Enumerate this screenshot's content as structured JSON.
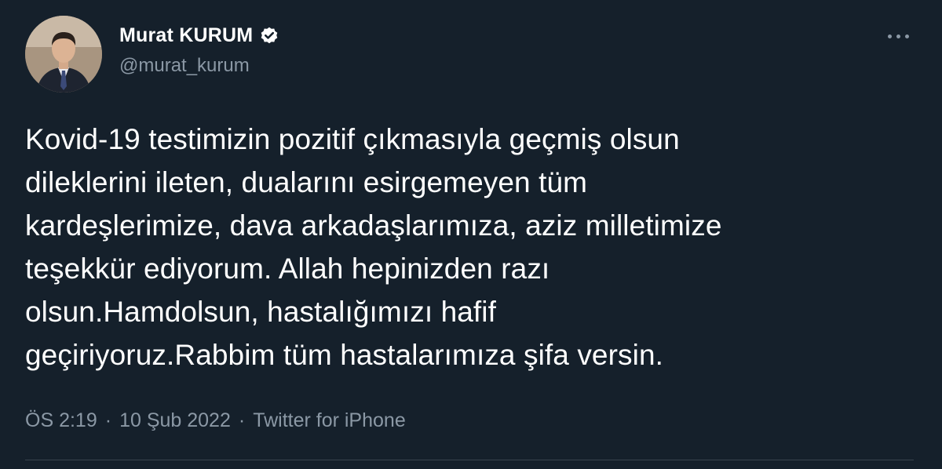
{
  "author": {
    "display_name": "Murat KURUM",
    "handle": "@murat_kurum",
    "verified": true
  },
  "tweet": {
    "text": "Kovid-19 testimizin pozitif çıkmasıyla geçmiş olsun\ndileklerini ileten, dualarını esirgemeyen tüm\nkardeşlerimize, dava arkadaşlarımıza, aziz milletimize\nteşekkür ediyorum. Allah hepinizden razı\nolsun.Hamdolsun, hastalığımızı hafif\ngeçiriyoruz.Rabbim tüm hastalarımıza şifa versin.",
    "time": "ÖS 2:19",
    "date": "10 Şub 2022",
    "separator": "·",
    "source": "Twitter for iPhone"
  },
  "icons": {
    "verified": "verified-badge-icon",
    "more": "more-options-icon"
  },
  "colors": {
    "background": "#15202b",
    "text_primary": "#ffffff",
    "text_secondary": "#8b98a5",
    "divider": "#38444d"
  }
}
